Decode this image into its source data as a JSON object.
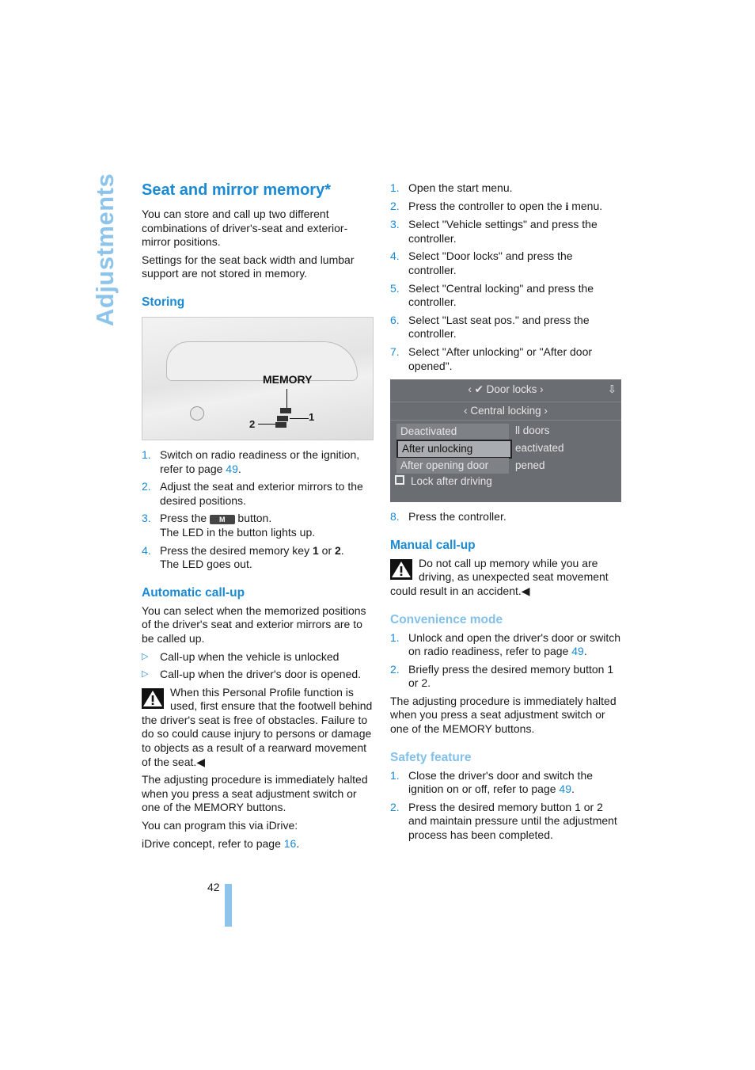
{
  "side_label": "Adjustments",
  "left": {
    "title": "Seat and mirror memory*",
    "intro1": "You can store and call up two different combinations of driver's-seat and exterior-mirror positions.",
    "intro2": "Settings for the seat back width and lumbar support are not stored in memory.",
    "storing": "Storing",
    "figure": {
      "memory": "MEMORY",
      "key1": "1",
      "key2": "2"
    },
    "steps": [
      {
        "n": "1.",
        "pre": "Switch on radio readiness or the ignition, refer to page ",
        "link": "49",
        "post": "."
      },
      {
        "n": "2.",
        "text": "Adjust the seat and exterior mirrors to the desired positions."
      },
      {
        "n": "3.",
        "pre": "Press the ",
        "btn": "M",
        "post": " button.",
        "line2": "The LED in the button lights up."
      },
      {
        "n": "4.",
        "pre": "Press the desired memory key ",
        "b1": "1",
        "mid": " or ",
        "b2": "2",
        "post": ".",
        "line2": "The LED goes out."
      }
    ],
    "auto_heading": "Automatic call-up",
    "auto_text": "You can select when the memorized positions of the driver's seat and exterior mirrors are to be called up.",
    "bullets": [
      "Call-up when the vehicle is unlocked",
      "Call-up when the driver's door is opened."
    ],
    "warning": "When this Personal Profile function is used, first ensure that the footwell behind the driver's seat is free of obstacles. Failure to do so could cause injury to persons or damage to objects as a result of a rearward movement of the seat.◀",
    "halted": "The adjusting procedure is immediately halted when you press a seat adjustment switch or one of the MEMORY buttons.",
    "program": "You can program this via iDrive:",
    "idrive_pre": "iDrive concept, refer to page ",
    "idrive_link": "16",
    "idrive_post": "."
  },
  "right": {
    "steps": [
      {
        "n": "1.",
        "text": "Open the start menu."
      },
      {
        "n": "2.",
        "pre": "Press the controller to open the ",
        "icon": "i",
        "post": " menu."
      },
      {
        "n": "3.",
        "text": "Select \"Vehicle settings\" and press the controller."
      },
      {
        "n": "4.",
        "text": "Select \"Door locks\" and press the controller."
      },
      {
        "n": "5.",
        "text": "Select \"Central locking\" and press the controller."
      },
      {
        "n": "6.",
        "text": "Select \"Last seat pos.\" and press the controller."
      },
      {
        "n": "7.",
        "text": "Select \"After unlocking\" or \"After door opened\"."
      }
    ],
    "screen": {
      "title": "Door locks",
      "subtitle": "Central locking",
      "options": [
        "Deactivated",
        "After unlocking",
        "After opening door"
      ],
      "selected": "After unlocking",
      "background": [
        "ll doors",
        "eactivated",
        "pened"
      ],
      "checkbox": "Lock after driving"
    },
    "step8": {
      "n": "8.",
      "text": "Press the controller."
    },
    "manual_heading": "Manual call-up",
    "manual_warning": "Do not call up memory while you are driving, as unexpected seat movement could result in an accident.◀",
    "conv_heading": "Convenience mode",
    "conv_steps": [
      {
        "n": "1.",
        "pre": "Unlock and open the driver's door or switch on radio readiness, refer to page ",
        "link": "49",
        "post": "."
      },
      {
        "n": "2.",
        "text": "Briefly press the desired memory button 1 or 2."
      }
    ],
    "conv_text": "The adjusting procedure is immediately halted when you press a seat adjustment switch or one of the MEMORY buttons.",
    "safety_heading": "Safety feature",
    "safety_steps": [
      {
        "n": "1.",
        "pre": "Close the driver's door and switch the ignition on or off, refer to page ",
        "link": "49",
        "post": "."
      },
      {
        "n": "2.",
        "text": "Press the desired memory button 1 or 2 and maintain pressure until the adjustment process has been completed."
      }
    ]
  },
  "page_number": "42",
  "colors": {
    "accent": "#1a8ad4",
    "light_accent": "#8cc4ec"
  }
}
